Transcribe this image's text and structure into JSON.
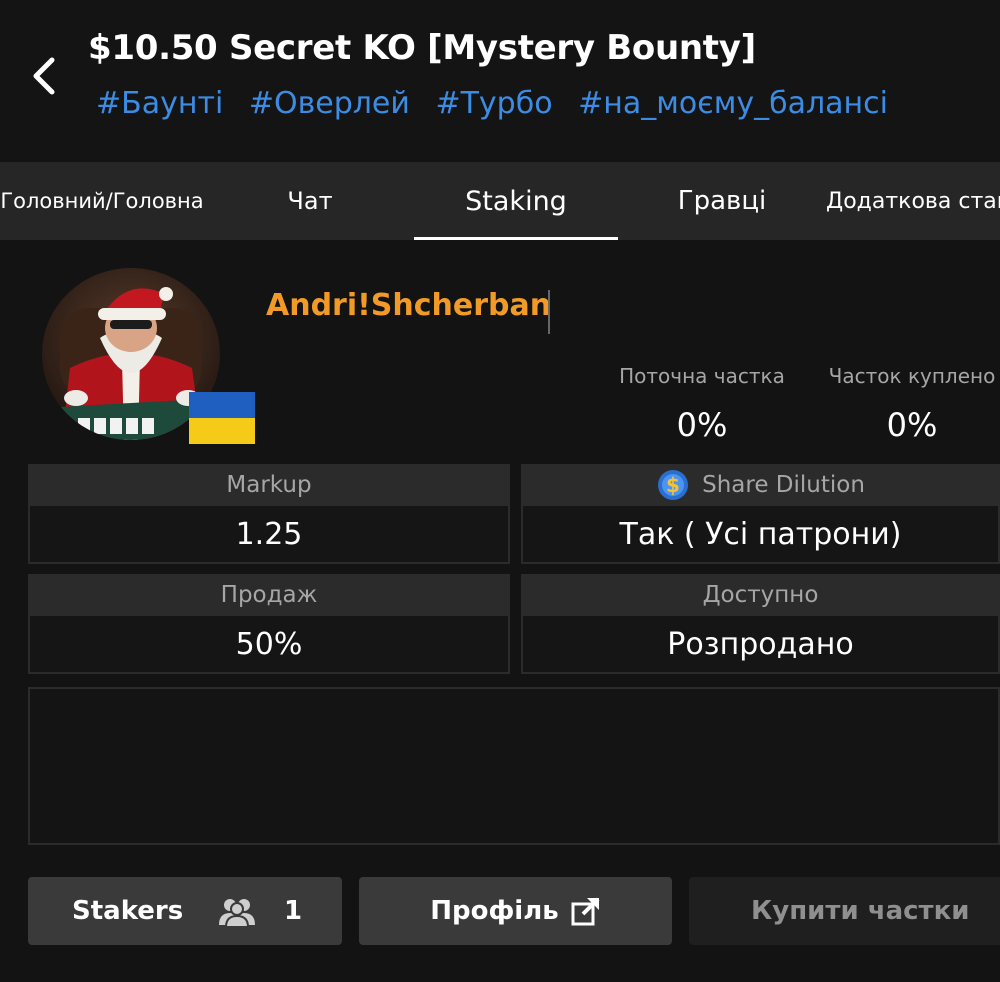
{
  "header": {
    "title": "$10.50 Secret KO [Mystery Bounty]",
    "tags": [
      "#Баунті",
      "#Оверлей",
      "#Турбо",
      "#на_моєму_балансі"
    ]
  },
  "tabs": [
    {
      "label": "Головний/Головна"
    },
    {
      "label": "Чат"
    },
    {
      "label": "Staking",
      "active": true
    },
    {
      "label": "Гравці"
    },
    {
      "label": "Додаткова став"
    }
  ],
  "profile": {
    "username": "Andri!Shcherban",
    "flag": "ukraine",
    "stats": [
      {
        "label": "Поточна частка",
        "value": "0%"
      },
      {
        "label": "Часток куплено",
        "value": "0%"
      }
    ]
  },
  "info": {
    "markup": {
      "label": "Markup",
      "value": "1.25"
    },
    "dilution": {
      "label": "Share Dilution",
      "value": "Так ( Усі патрони)",
      "icon": "dollar-coin-icon"
    },
    "sale": {
      "label": "Продаж",
      "value": "50%"
    },
    "available": {
      "label": "Доступно",
      "value": "Розпродано"
    }
  },
  "buttons": {
    "stakers_label": "Stakers",
    "stakers_count": "1",
    "profile_label": "Профіль",
    "buy_label": "Купити частки"
  },
  "colors": {
    "accent_orange": "#f19a27",
    "tag_blue": "#3d8ce3",
    "background": "#131313"
  }
}
